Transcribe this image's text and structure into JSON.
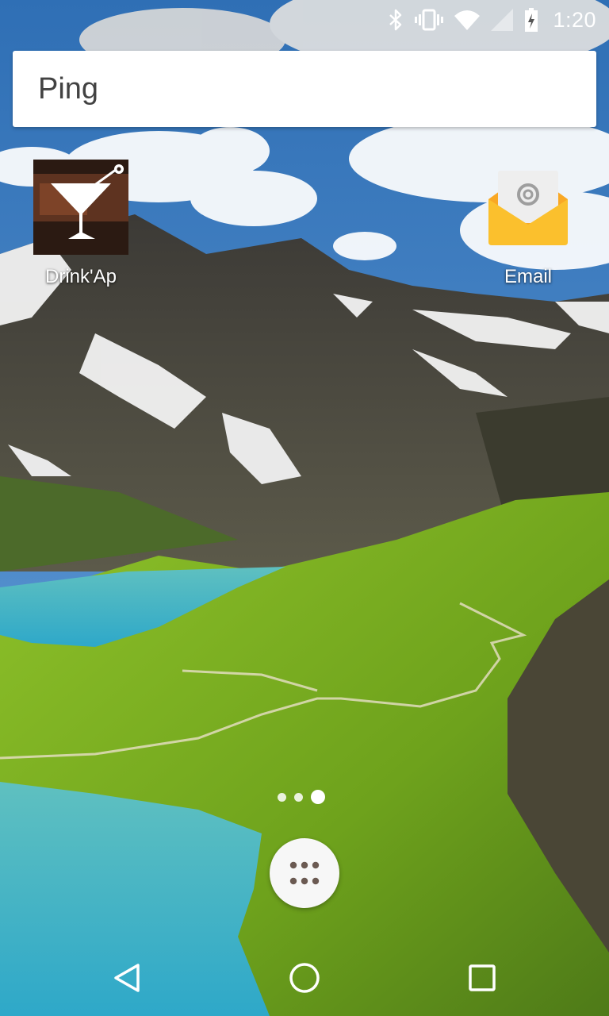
{
  "status_bar": {
    "time": "1:20",
    "icons": [
      "bluetooth-icon",
      "vibrate-icon",
      "wifi-icon",
      "cell-signal-icon",
      "battery-charging-icon"
    ]
  },
  "search": {
    "text": "Ping"
  },
  "home_apps": [
    {
      "label": "Drink'Ap",
      "icon": "cocktail-glass-icon"
    },
    {
      "label": "Email",
      "icon": "email-envelope-icon"
    }
  ],
  "page_indicator": {
    "pages": 3,
    "current": 3
  },
  "dock": {
    "app_drawer_icon": "apps-grid-icon"
  },
  "nav_bar": {
    "buttons": [
      "back-icon",
      "home-icon",
      "recents-icon"
    ]
  },
  "colors": {
    "email_envelope": "#FBC02D",
    "drink_tile": "#2b1a12",
    "search_text": "#424242"
  }
}
